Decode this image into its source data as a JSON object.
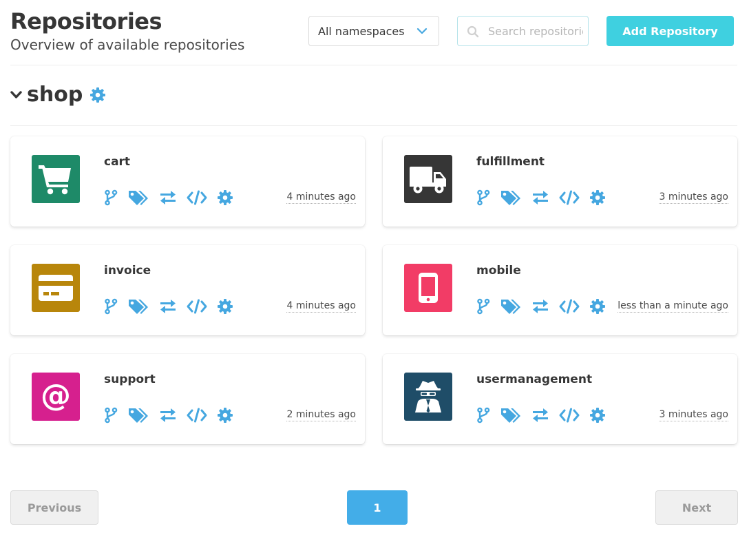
{
  "header": {
    "title": "Repositories",
    "subtitle": "Overview of available repositories"
  },
  "namespace_filter": {
    "selected": "All namespaces"
  },
  "search": {
    "placeholder": "Search repositories",
    "value": ""
  },
  "add_button": {
    "label": "Add Repository"
  },
  "namespace": {
    "name": "shop",
    "icons": [
      "chevron-down-icon",
      "gear-icon"
    ]
  },
  "colors": {
    "accent_blue": "#45a7e0",
    "add_button": "#3fd0e0",
    "pagination_active": "#43ade8"
  },
  "repositories": [
    {
      "name": "cart",
      "time": "4 minutes ago",
      "icon": "shopping-cart-icon",
      "color": "#1e8a68"
    },
    {
      "name": "fulfillment",
      "time": "3 minutes ago",
      "icon": "truck-icon",
      "color": "#363636"
    },
    {
      "name": "invoice",
      "time": "4 minutes ago",
      "icon": "credit-card-icon",
      "color": "#b8860b"
    },
    {
      "name": "mobile",
      "time": "less than a minute ago",
      "icon": "mobile-phone-icon",
      "color": "#f23c66"
    },
    {
      "name": "support",
      "time": "2 minutes ago",
      "icon": "at-sign-icon",
      "color": "#d6208e"
    },
    {
      "name": "usermanagement",
      "time": "3 minutes ago",
      "icon": "user-secret-icon",
      "color": "#1f4d68"
    }
  ],
  "repo_actions": [
    "branches-icon",
    "tags-icon",
    "changesets-icon",
    "sources-icon",
    "settings-icon"
  ],
  "pagination": {
    "previous": "Previous",
    "current": "1",
    "next": "Next"
  }
}
